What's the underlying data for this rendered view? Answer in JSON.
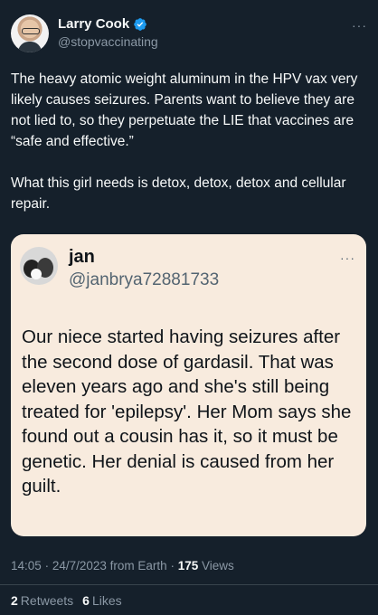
{
  "author": {
    "display_name": "Larry Cook",
    "handle": "@stopvaccinating",
    "verified_icon": "verified-badge-icon"
  },
  "tweet": {
    "text": "The heavy atomic weight aluminum in the HPV vax very likely causes seizures. Parents want to believe they are not lied to, so they perpetuate the LIE that vaccines are “safe and effective.”\n\nWhat this girl needs is detox, detox, detox and cellular repair."
  },
  "quoted_tweet": {
    "display_name": "jan",
    "handle": "@janbrya72881733",
    "text": "Our niece started having seizures after the second dose of gardasil. That was eleven years ago and she's still being treated for 'epilepsy'. Her Mom says she found out a cousin has it, so it must be genetic. Her denial is caused from her guilt."
  },
  "meta": {
    "time": "14:05",
    "sep1": "·",
    "date": "24/7/2023",
    "source": "from Earth",
    "sep2": "·",
    "views_count": "175",
    "views_label": "Views"
  },
  "stats": {
    "retweets_count": "2",
    "retweets_label": "Retweets",
    "likes_count": "6",
    "likes_label": "Likes"
  },
  "more_glyph": "···",
  "colors": {
    "background": "#15202b",
    "quote_background": "#f8ebde",
    "verified": "#1d9bf0",
    "secondary_text": "#8b98a5"
  }
}
